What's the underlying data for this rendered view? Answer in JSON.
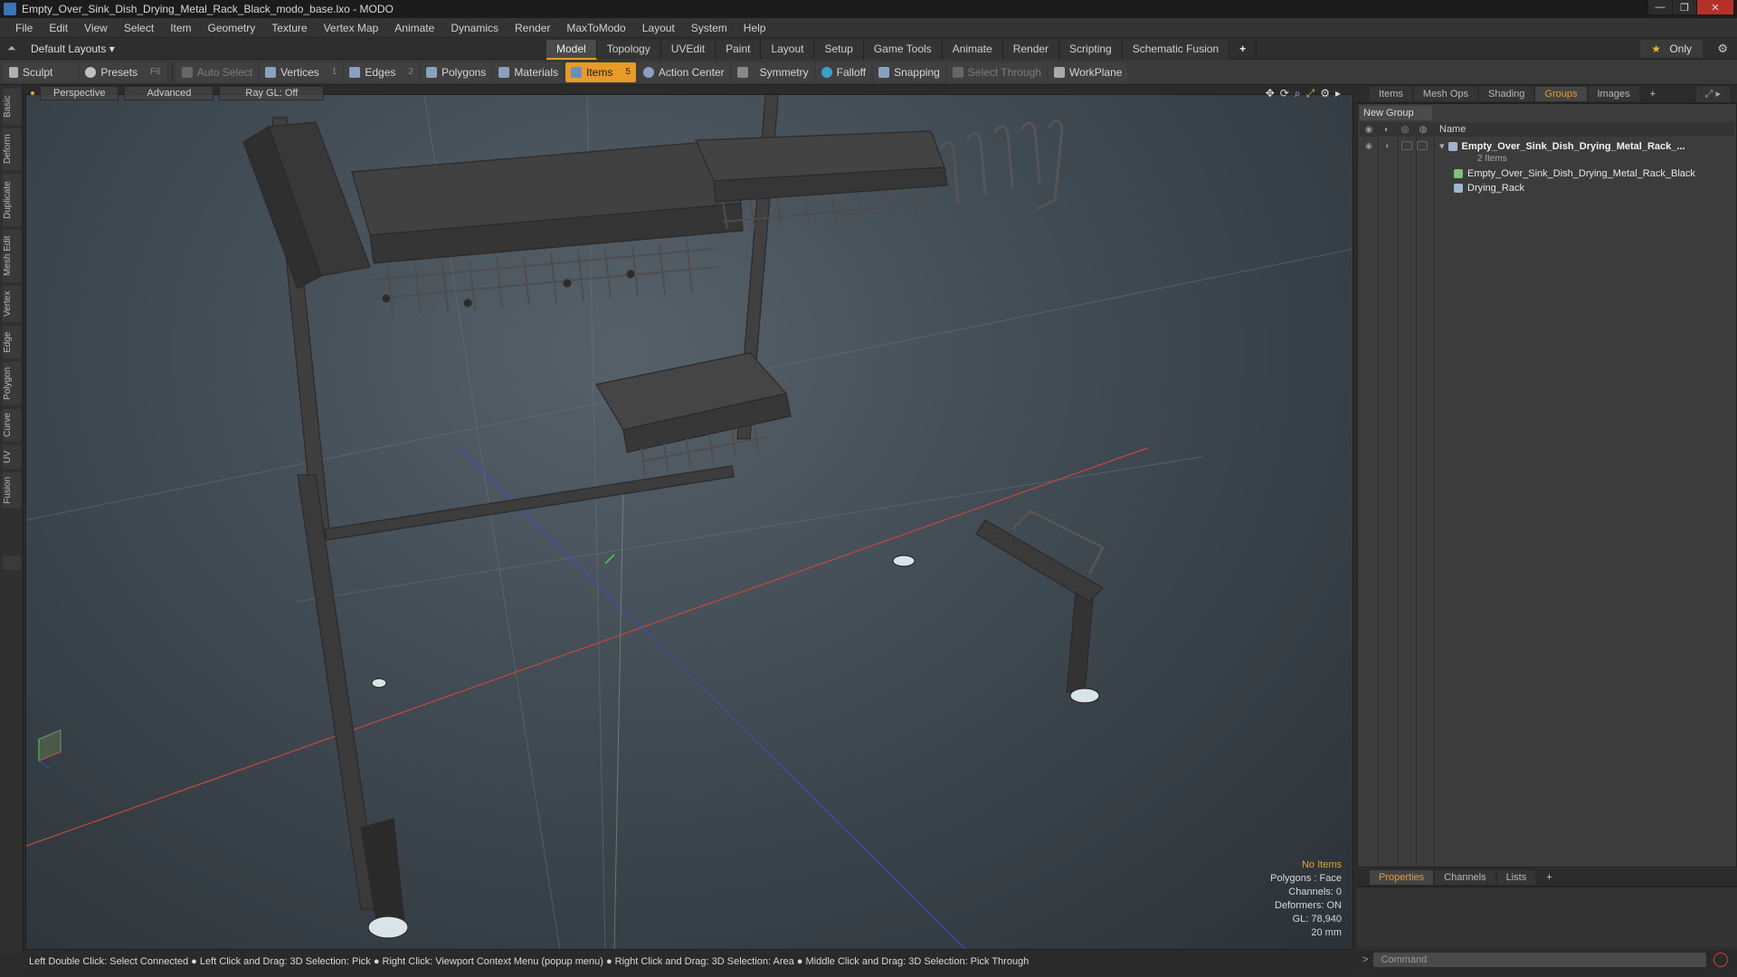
{
  "window": {
    "title": "Empty_Over_Sink_Dish_Drying_Metal_Rack_Black_modo_base.lxo - MODO",
    "controls": [
      "—",
      "❐",
      "✕"
    ]
  },
  "menu": [
    "File",
    "Edit",
    "View",
    "Select",
    "Item",
    "Geometry",
    "Texture",
    "Vertex Map",
    "Animate",
    "Dynamics",
    "Render",
    "MaxToModo",
    "Layout",
    "System",
    "Help"
  ],
  "layout_bar": {
    "layouts_label": "Default Layouts ▾",
    "tabs": [
      "Model",
      "Topology",
      "UVEdit",
      "Paint",
      "Layout",
      "Setup",
      "Game Tools",
      "Animate",
      "Render",
      "Scripting",
      "Schematic Fusion"
    ],
    "active_tab": "Model",
    "plus": "+",
    "only_label": "Only"
  },
  "toolbar": {
    "sculpt": "Sculpt",
    "presets": "Presets",
    "presets_key": "F6",
    "auto_select": "Auto Select",
    "vertices": "Vertices",
    "vertices_count": "1",
    "edges": "Edges",
    "edges_count": "2",
    "polygons": "Polygons",
    "materials": "Materials",
    "items": "Items",
    "items_count": "5",
    "action_center": "Action Center",
    "symmetry": "Symmetry",
    "falloff": "Falloff",
    "snapping": "Snapping",
    "select_through": "Select Through",
    "workplane": "WorkPlane"
  },
  "left_tabs": [
    "Basic",
    "Deform",
    "Duplicate",
    "Mesh Edit",
    "Vertex",
    "Edge",
    "Polygon",
    "Curve",
    "UV",
    "Fusion"
  ],
  "viewport": {
    "view_mode": "Perspective",
    "shading": "Advanced",
    "raygl": "Ray GL: Off",
    "info": {
      "selection": "No Items",
      "polygons": "Polygons : Face",
      "channels": "Channels: 0",
      "deformers": "Deformers: ON",
      "gl": "GL: 78,940",
      "unit": "20 mm"
    }
  },
  "status_bar": "Left Double Click: Select Connected ● Left Click and Drag: 3D Selection: Pick ● Right Click: Viewport Context Menu (popup menu) ● Right Click and Drag: 3D Selection: Area ● Middle Click and Drag: 3D Selection: Pick Through",
  "right_panel": {
    "tabs": [
      "Items",
      "Mesh Ops",
      "Shading",
      "Groups",
      "Images"
    ],
    "active_tab": "Groups",
    "new_group": "New Group",
    "column_name": "Name",
    "tree": [
      {
        "label": "Empty_Over_Sink_Dish_Drying_Metal_Rack_...",
        "sub": "2 Items"
      },
      {
        "label": "Empty_Over_Sink_Dish_Drying_Metal_Rack_Black"
      },
      {
        "label": "Drying_Rack"
      }
    ],
    "bottom_tabs": [
      "Properties",
      "Channels",
      "Lists"
    ],
    "bottom_active": "Properties",
    "command_placeholder": "Command"
  },
  "colors": {
    "accent": "#e89b27",
    "axis_x": "#c8473d",
    "axis_z": "#3b50b8"
  }
}
